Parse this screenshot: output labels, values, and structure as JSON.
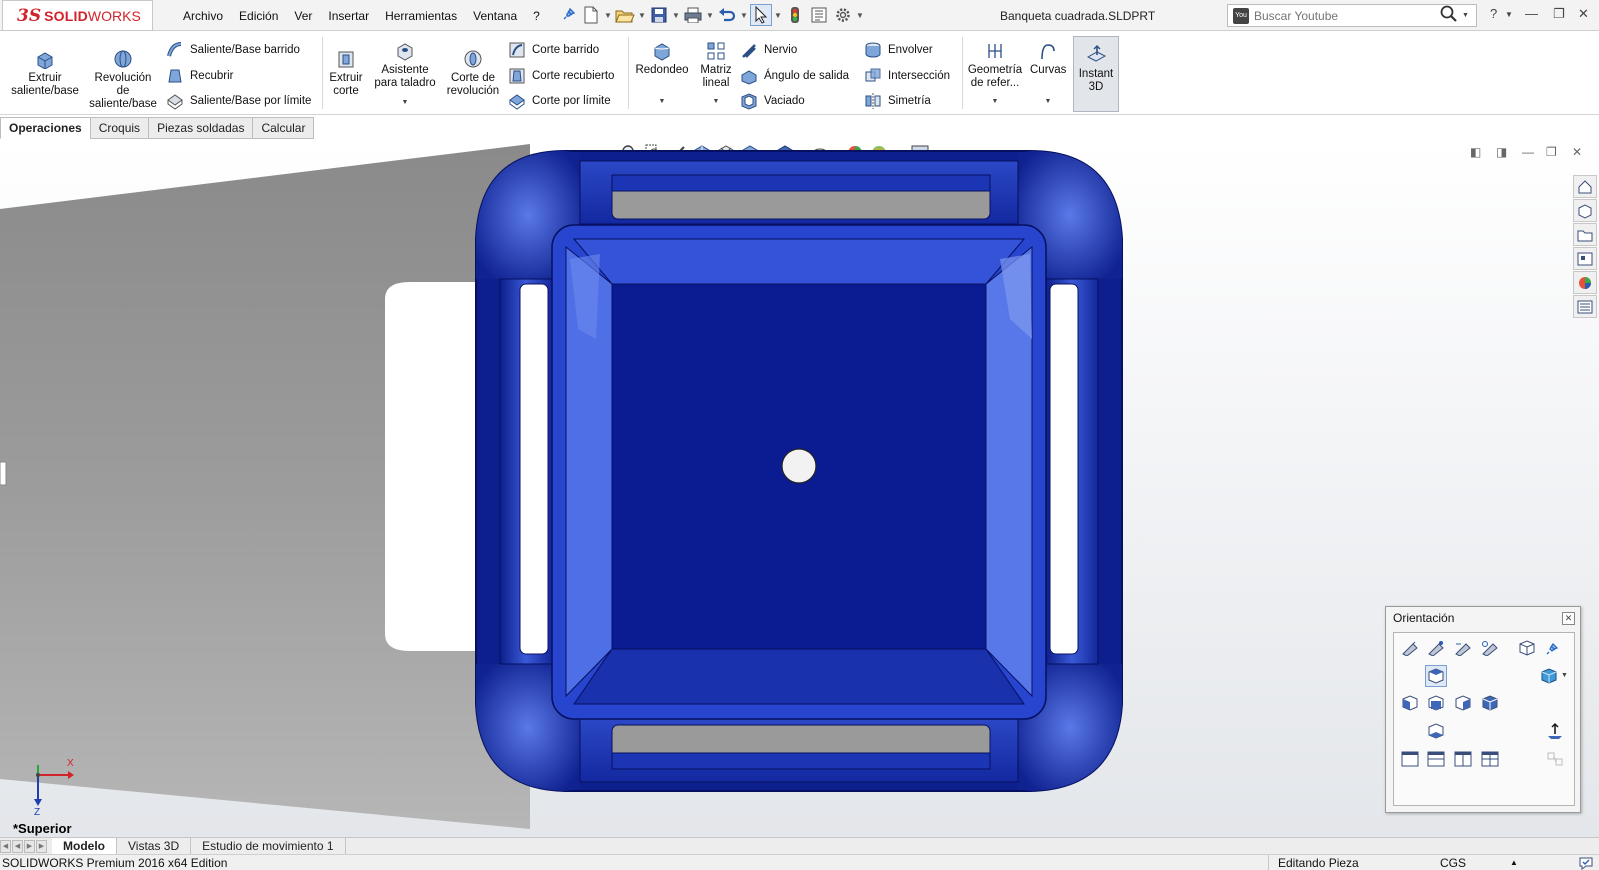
{
  "app": {
    "brand_ds": "3S",
    "brand_name": "SOLID",
    "brand_name2": "WORKS"
  },
  "menu": [
    "Archivo",
    "Edición",
    "Ver",
    "Insertar",
    "Herramientas",
    "Ventana",
    "?"
  ],
  "document_title": "Banqueta cuadrada.SLDPRT",
  "search": {
    "placeholder": "Buscar Youtube"
  },
  "ribbon": {
    "extrude_boss": "Extruir saliente/base",
    "revolve_boss": "Revolución de saliente/base",
    "swept_boss": "Saliente/Base barrido",
    "loft": "Recubrir",
    "boundary_boss": "Saliente/Base por límite",
    "extruded_cut": "Extruir corte",
    "hole_wizard": "Asistente para taladro",
    "revolved_cut": "Corte de revolución",
    "swept_cut": "Corte barrido",
    "lofted_cut": "Corte recubierto",
    "boundary_cut": "Corte por límite",
    "fillet": "Redondeo",
    "linear_pattern": "Matriz lineal",
    "rib": "Nervio",
    "draft": "Ángulo de salida",
    "shell": "Vaciado",
    "wrap": "Envolver",
    "intersect": "Intersección",
    "mirror": "Simetría",
    "ref_geometry": "Geometría de refer...",
    "curves": "Curvas",
    "instant3d": "Instant 3D"
  },
  "tabs": [
    {
      "label": "Operaciones",
      "active": true
    },
    {
      "label": "Croquis",
      "active": false
    },
    {
      "label": "Piezas soldadas",
      "active": false
    },
    {
      "label": "Calcular",
      "active": false
    }
  ],
  "viewport": {
    "view_name": "*Superior",
    "axis_x": "X",
    "axis_z": "Z"
  },
  "orientation_panel": {
    "title": "Orientación"
  },
  "bottom_tabs": [
    {
      "label": "Modelo",
      "active": true
    },
    {
      "label": "Vistas 3D",
      "active": false
    },
    {
      "label": "Estudio de movimiento 1",
      "active": false
    }
  ],
  "status": {
    "edition": "SOLIDWORKS Premium 2016 x64 Edition",
    "mode": "Editando Pieza",
    "units": "CGS"
  },
  "colors": {
    "model_blue": "#1b2fa8",
    "brand_red": "#d2232a"
  }
}
